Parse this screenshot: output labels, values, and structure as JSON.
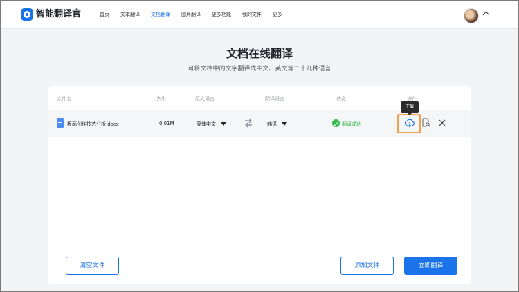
{
  "header": {
    "brand": "智能翻译官",
    "nav": [
      {
        "label": "首页",
        "active": false
      },
      {
        "label": "文本翻译",
        "active": false
      },
      {
        "label": "文档翻译",
        "active": true
      },
      {
        "label": "图片翻译",
        "active": false
      },
      {
        "label": "更多功能",
        "active": false
      },
      {
        "label": "我的文件",
        "active": false
      },
      {
        "label": "更多",
        "active": false
      }
    ],
    "accent_color": "#1a73e8"
  },
  "page": {
    "title": "文档在线翻译",
    "subtitle": "可将文档中的文字翻译成中文、英文等二十几种语言"
  },
  "table": {
    "columns": [
      "文件名",
      "大小",
      "原文语言",
      "翻译语言",
      "状态",
      "操作"
    ],
    "rows": [
      {
        "file_name": "板画创作技艺分析.docx",
        "size": "0.01M",
        "source_lang": "简体中文",
        "target_lang": "韩语",
        "status": "翻译成功",
        "status_color": "#35b84a"
      }
    ],
    "tooltip": "下载"
  },
  "buttons": {
    "clear": "清空文件",
    "add": "添加文件",
    "translate": "立即翻译"
  }
}
